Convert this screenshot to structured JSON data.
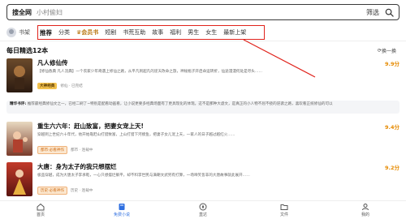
{
  "search": {
    "tag": "搜全网",
    "placeholder": "小村偷妇",
    "filter_label": "筛选"
  },
  "nav": {
    "shelf_label": "书架",
    "categories": [
      {
        "label": "推荐",
        "active": true
      },
      {
        "label": "分类"
      },
      {
        "label": "会员书",
        "vip": true
      },
      {
        "label": "短剧"
      },
      {
        "label": "书荒互助"
      },
      {
        "label": "故事"
      },
      {
        "label": "福利"
      },
      {
        "label": "男生"
      },
      {
        "label": "女生"
      },
      {
        "label": "最新上架"
      }
    ]
  },
  "section": {
    "title": "每日精选12本",
    "more_label": "换一换"
  },
  "books": [
    {
      "title": "凡人修仙传",
      "score": "9.9分",
      "desc": "【修仙香典 凡人流典】一个农家少年奇遇上修仙之路，从平凡到超凡的逆天改命之旅，神秘瓶子开启命运转折，仙途漫漫何处是尽头……",
      "badge": "大神经典",
      "meta": "修仙 · 已完结",
      "review_label": "精华书评:",
      "review": "推荐最经典修仙文之一，已经二刷了~特别是配看动画看，让小说更要多经典场面有了更具现化的体现。这不是那种大虐文，是真正的小人物不屈不挠的逆袭之路，喜欢看正统修仙的可以"
    },
    {
      "title": "重生六六年：赶山致富，把妻女宠上天!",
      "score": "9.4分",
      "desc": "穿越到上世纪六十年代，他开始靠赶山打猎致富，上山打猎下河摸鱼，把妻子女儿宠上天，一家人的日子越过越红火……",
      "badge": "都市·必看神作",
      "meta": "都市 · 连载中"
    },
    {
      "title": "大唐：身为太子的我只想摆烂",
      "score": "9.2分",
      "desc": "极品穿越，成为大唐太子李承乾，一心只想摆烂躺平，却不料李世民与满朝文武另有打算，一场啼笑皆非的大唐故事就此展开……",
      "badge": "历史·必看神作",
      "meta": "历史 · 连载中"
    }
  ],
  "bottom_nav": [
    {
      "label": "首页",
      "icon": "home-icon"
    },
    {
      "label": "免费小说",
      "icon": "book-icon",
      "active": true
    },
    {
      "label": "直达",
      "icon": "compass-icon"
    },
    {
      "label": "文件",
      "icon": "folder-icon"
    },
    {
      "label": "我的",
      "icon": "user-icon"
    }
  ],
  "colors": {
    "highlight": "#e0231c",
    "score": "#e68a00",
    "active_tab": "#2f6fe0"
  }
}
